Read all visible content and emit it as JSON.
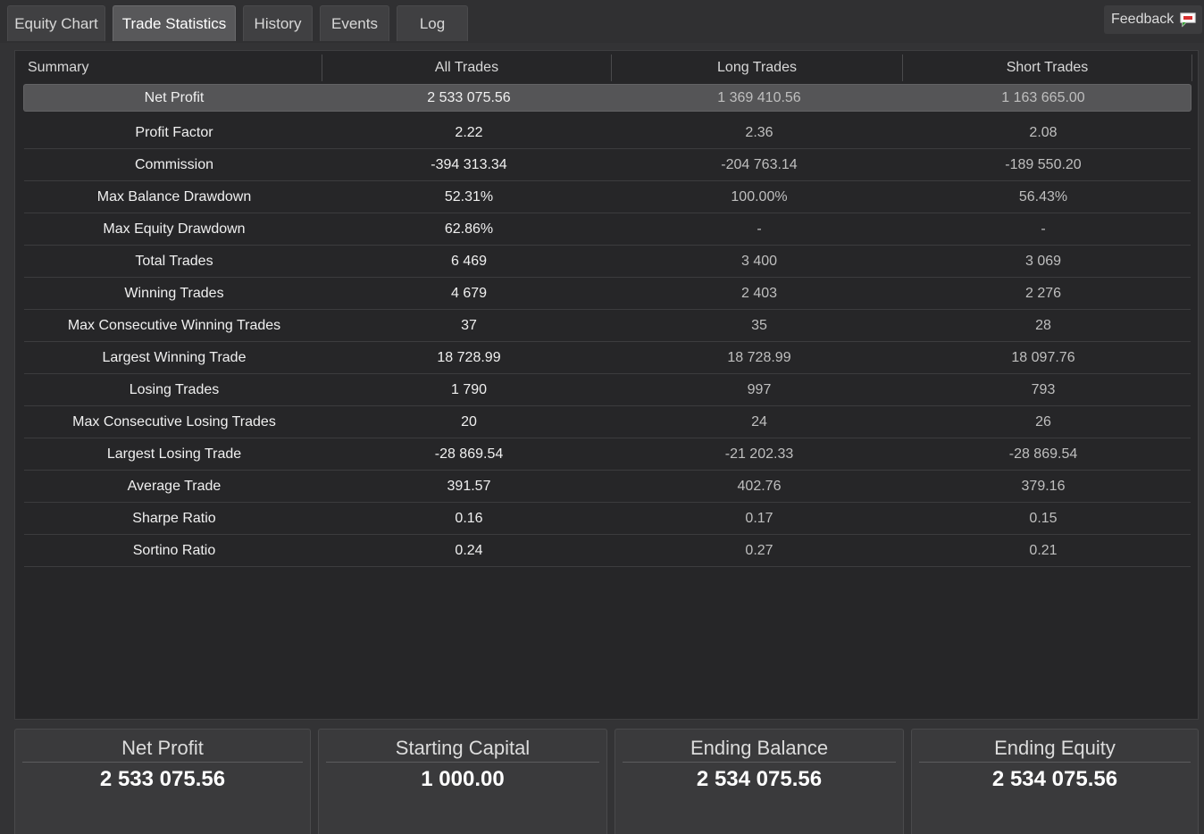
{
  "tabs": [
    {
      "label": "Equity Chart"
    },
    {
      "label": "Trade Statistics"
    },
    {
      "label": "History"
    },
    {
      "label": "Events"
    },
    {
      "label": "Log"
    }
  ],
  "feedback_label": "Feedback",
  "table": {
    "headers": [
      "Summary",
      "All Trades",
      "Long Trades",
      "Short Trades"
    ],
    "rows": [
      {
        "label": "Net Profit",
        "all": "2 533 075.56",
        "long": "1 369 410.56",
        "short": "1 163 665.00"
      },
      {
        "label": "Profit Factor",
        "all": "2.22",
        "long": "2.36",
        "short": "2.08"
      },
      {
        "label": "Commission",
        "all": "-394 313.34",
        "long": "-204 763.14",
        "short": "-189 550.20"
      },
      {
        "label": "Max Balance Drawdown",
        "all": "52.31%",
        "long": "100.00%",
        "short": "56.43%"
      },
      {
        "label": "Max Equity Drawdown",
        "all": "62.86%",
        "long": "-",
        "short": "-"
      },
      {
        "label": "Total Trades",
        "all": "6 469",
        "long": "3 400",
        "short": "3 069"
      },
      {
        "label": "Winning Trades",
        "all": "4 679",
        "long": "2 403",
        "short": "2 276"
      },
      {
        "label": "Max Consecutive Winning Trades",
        "all": "37",
        "long": "35",
        "short": "28"
      },
      {
        "label": "Largest Winning Trade",
        "all": "18 728.99",
        "long": "18 728.99",
        "short": "18 097.76"
      },
      {
        "label": "Losing Trades",
        "all": "1 790",
        "long": "997",
        "short": "793"
      },
      {
        "label": "Max Consecutive Losing Trades",
        "all": "20",
        "long": "24",
        "short": "26"
      },
      {
        "label": "Largest Losing Trade",
        "all": "-28 869.54",
        "long": "-21 202.33",
        "short": "-28 869.54"
      },
      {
        "label": "Average Trade",
        "all": "391.57",
        "long": "402.76",
        "short": "379.16"
      },
      {
        "label": "Sharpe Ratio",
        "all": "0.16",
        "long": "0.17",
        "short": "0.15"
      },
      {
        "label": "Sortino Ratio",
        "all": "0.24",
        "long": "0.27",
        "short": "0.21"
      }
    ]
  },
  "summary_cards": [
    {
      "title": "Net Profit",
      "value": "2 533 075.56"
    },
    {
      "title": "Starting Capital",
      "value": "1 000.00"
    },
    {
      "title": "Ending Balance",
      "value": "2 534 075.56"
    },
    {
      "title": "Ending Equity",
      "value": "2 534 075.56"
    }
  ]
}
